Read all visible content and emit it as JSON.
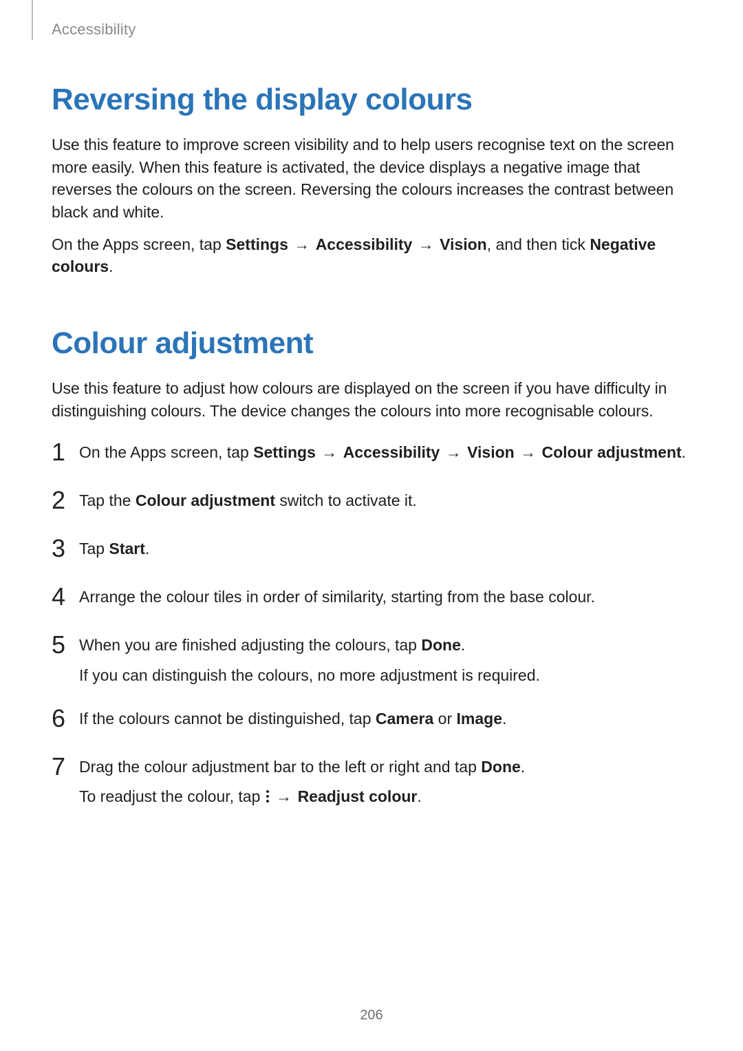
{
  "header": {
    "section": "Accessibility"
  },
  "section1": {
    "title": "Reversing the display colours",
    "intro": "Use this feature to improve screen visibility and to help users recognise text on the screen more easily. When this feature is activated, the device displays a negative image that reverses the colours on the screen. Reversing the colours increases the contrast between black and white.",
    "path_prefix": "On the Apps screen, tap ",
    "nav1": "Settings",
    "nav2": "Accessibility",
    "nav3": "Vision",
    "path_mid": ", and then tick ",
    "nav_final": "Negative colours",
    "path_suffix": "."
  },
  "section2": {
    "title": "Colour adjustment",
    "intro": "Use this feature to adjust how colours are displayed on the screen if you have difficulty in distinguishing colours. The device changes the colours into more recognisable colours."
  },
  "steps": {
    "s1": {
      "prefix": "On the Apps screen, tap ",
      "nav1": "Settings",
      "nav2": "Accessibility",
      "nav3": "Vision",
      "nav4": "Colour adjustment",
      "suffix": "."
    },
    "s2": {
      "prefix": "Tap the ",
      "bold": "Colour adjustment",
      "suffix": " switch to activate it."
    },
    "s3": {
      "prefix": "Tap ",
      "bold": "Start",
      "suffix": "."
    },
    "s4": {
      "text": "Arrange the colour tiles in order of similarity, starting from the base colour."
    },
    "s5": {
      "prefix": "When you are finished adjusting the colours, tap ",
      "bold": "Done",
      "suffix": ".",
      "sub": "If you can distinguish the colours, no more adjustment is required."
    },
    "s6": {
      "prefix": "If the colours cannot be distinguished, tap ",
      "bold1": "Camera",
      "mid": " or ",
      "bold2": "Image",
      "suffix": "."
    },
    "s7": {
      "prefix": "Drag the colour adjustment bar to the left or right and tap ",
      "bold": "Done",
      "suffix": ".",
      "sub_prefix": "To readjust the colour, tap ",
      "sub_bold": "Readjust colour",
      "sub_suffix": "."
    }
  },
  "arrow": "→",
  "page_number": "206"
}
